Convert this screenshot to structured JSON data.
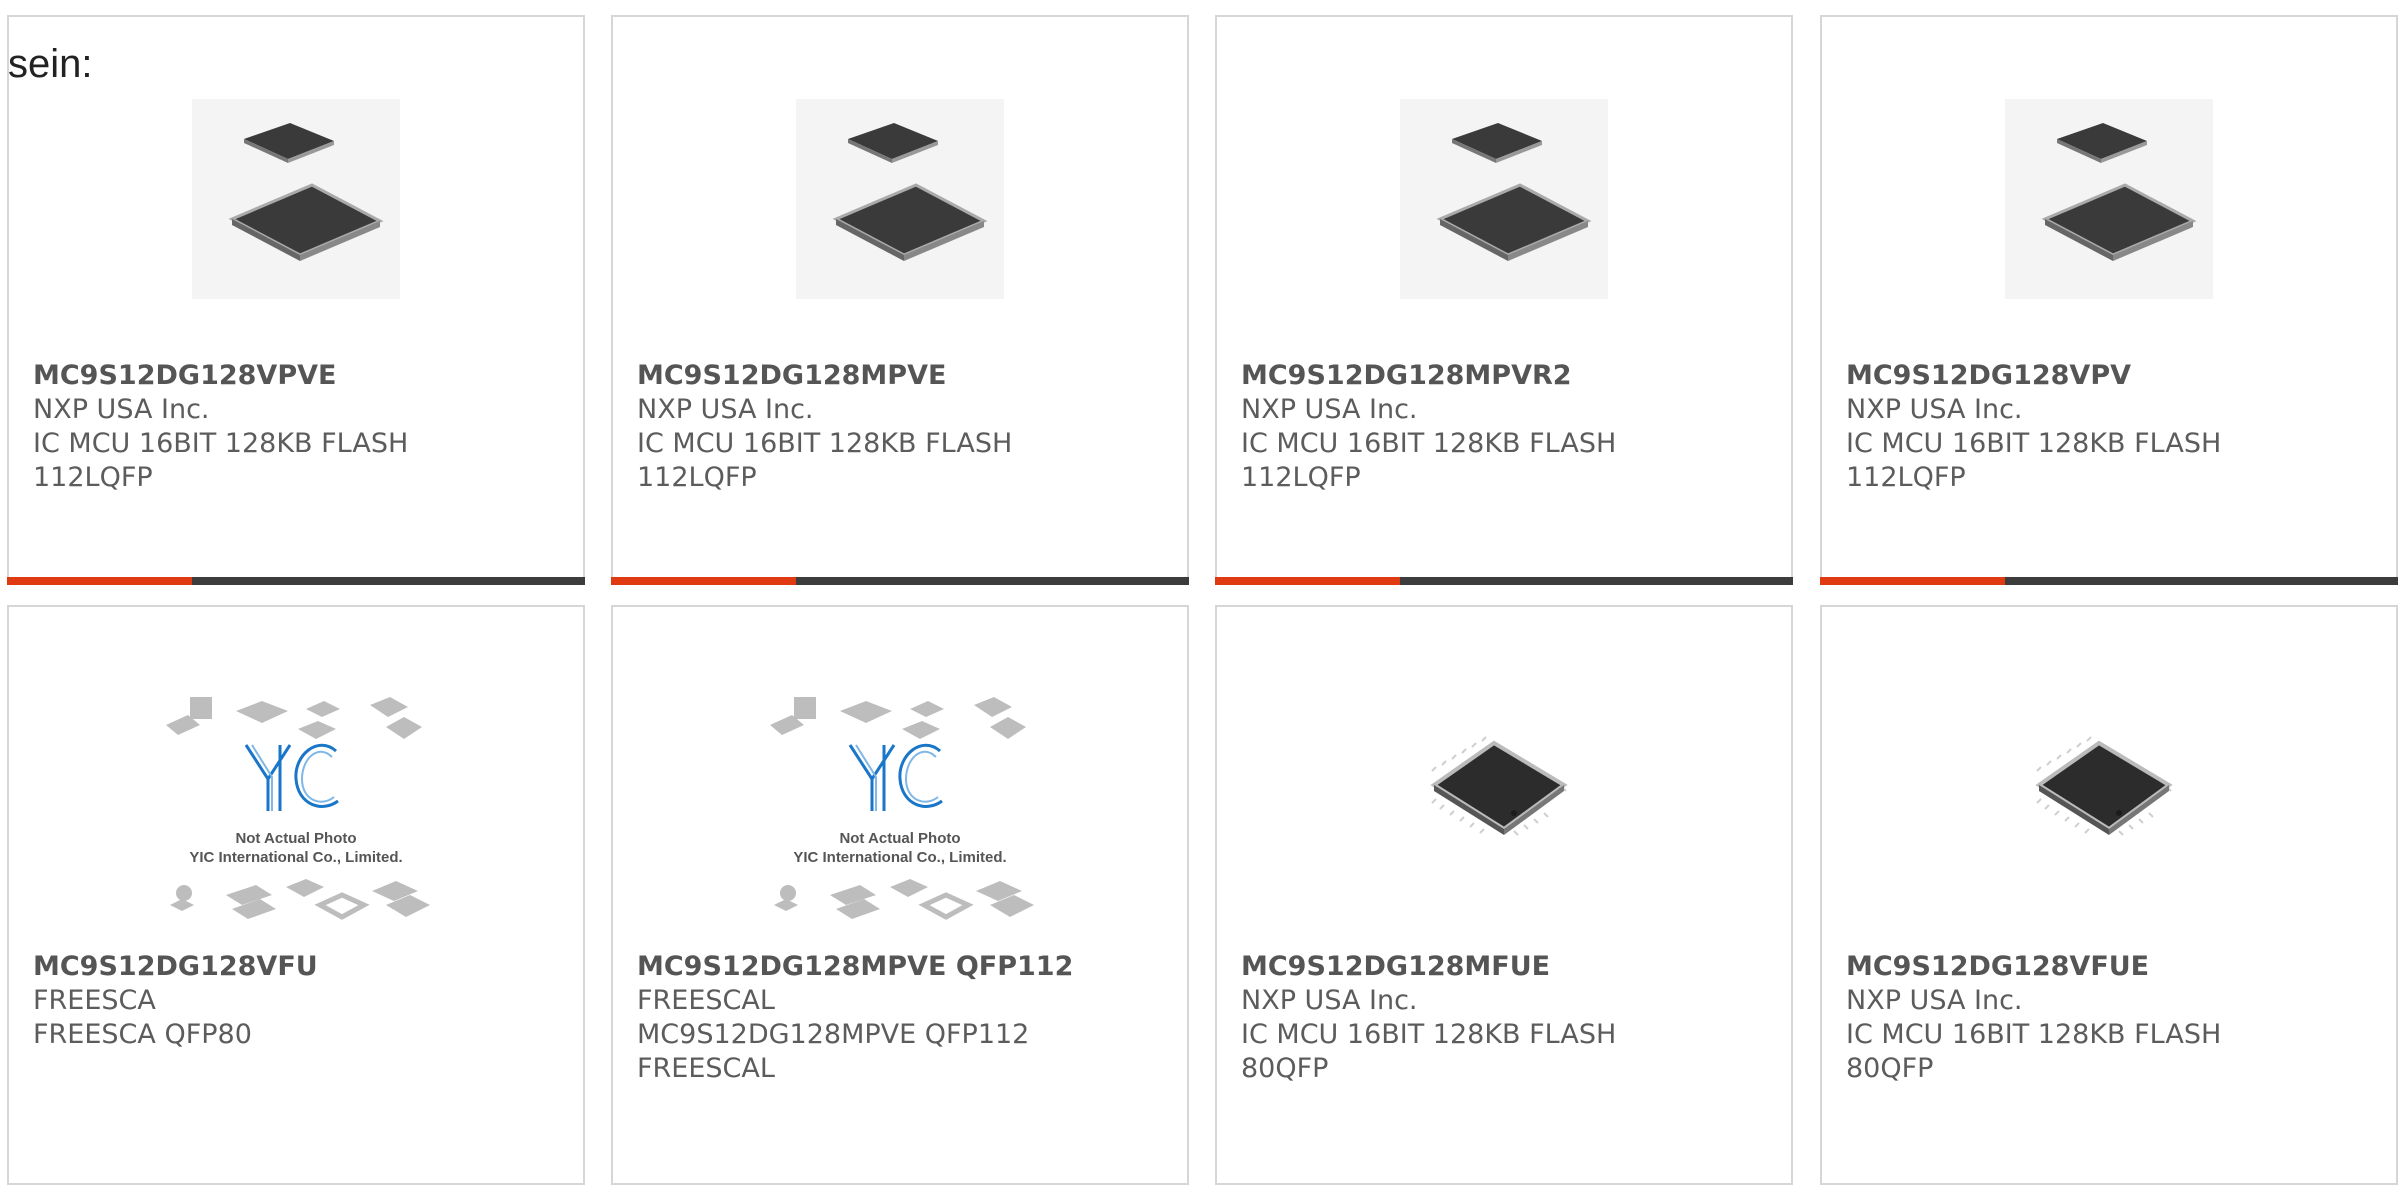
{
  "heading": "sein:",
  "colors": {
    "accent": "#e03a12",
    "bar": "#3c3c3c",
    "border": "#d6d6d6",
    "text": "#5c5c5c"
  },
  "products": [
    {
      "part": "MC9S12DG128VPVE",
      "maker": "NXP USA Inc.",
      "desc1": "IC MCU 16BIT 128KB FLASH",
      "desc2": "112LQFP",
      "image": "lqfp-chip-pair"
    },
    {
      "part": "MC9S12DG128MPVE",
      "maker": "NXP USA Inc.",
      "desc1": "IC MCU 16BIT 128KB FLASH",
      "desc2": "112LQFP",
      "image": "lqfp-chip-pair"
    },
    {
      "part": "MC9S12DG128MPVR2",
      "maker": "NXP USA Inc.",
      "desc1": "IC MCU 16BIT 128KB FLASH",
      "desc2": "112LQFP",
      "image": "lqfp-chip-pair"
    },
    {
      "part": "MC9S12DG128VPV",
      "maker": "NXP USA Inc.",
      "desc1": "IC MCU 16BIT 128KB FLASH",
      "desc2": "112LQFP",
      "image": "lqfp-chip-pair"
    },
    {
      "part": "MC9S12DG128VFU",
      "maker": "FREESCA",
      "desc1": "FREESCA QFP80",
      "desc2": "",
      "image": "placeholder-logo",
      "placeholder": {
        "logo": "YIC",
        "line1": "Not Actual Photo",
        "line2": "YIC International Co., Limited."
      }
    },
    {
      "part": "MC9S12DG128MPVE QFP112",
      "maker": "FREESCAL",
      "desc1": "MC9S12DG128MPVE QFP112",
      "desc2": "FREESCAL",
      "image": "placeholder-logo",
      "placeholder": {
        "logo": "YIC",
        "line1": "Not Actual Photo",
        "line2": "YIC International Co., Limited."
      }
    },
    {
      "part": "MC9S12DG128MFUE",
      "maker": "NXP USA Inc.",
      "desc1": "IC MCU 16BIT 128KB FLASH",
      "desc2": "80QFP",
      "image": "qfp-chip"
    },
    {
      "part": "MC9S12DG128VFUE",
      "maker": "NXP USA Inc.",
      "desc1": "IC MCU 16BIT 128KB FLASH",
      "desc2": "80QFP",
      "image": "qfp-chip"
    }
  ]
}
